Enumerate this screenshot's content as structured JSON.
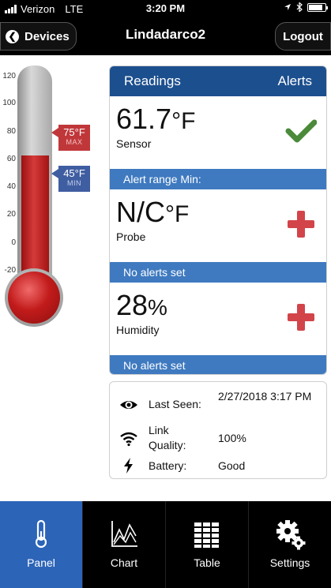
{
  "status_bar": {
    "carrier": "Verizon",
    "network": "LTE",
    "time": "3:20 PM"
  },
  "nav": {
    "back_label": "Devices",
    "title": "Lindadarco2",
    "logout_label": "Logout"
  },
  "thermometer": {
    "scale": [
      "120",
      "100",
      "80",
      "60",
      "40",
      "20",
      "0",
      "-20"
    ],
    "level_f": 63,
    "max": {
      "value": "75°F",
      "label": "MAX"
    },
    "min": {
      "value": "45°F",
      "label": "MIN"
    }
  },
  "readings": {
    "header_left": "Readings",
    "header_right": "Alerts",
    "items": [
      {
        "value": "61.7",
        "unit": "°F",
        "name": "Sensor",
        "alert_icon": "check-icon",
        "alert_text": "Alert range Min:"
      },
      {
        "value": "N/C",
        "unit": "°F",
        "name": "Probe",
        "alert_icon": "plus-icon",
        "alert_text": "No alerts set"
      },
      {
        "value": "28",
        "unit": "%",
        "name": "Humidity",
        "alert_icon": "plus-icon",
        "alert_text": "No alerts set"
      }
    ]
  },
  "info": {
    "last_seen_label": "Last Seen:",
    "last_seen_value": "2/27/2018 3:17 PM",
    "link_quality_label": "Link Quality:",
    "link_quality_value": "100%",
    "battery_label": "Battery:",
    "battery_value": "Good"
  },
  "tabs": [
    {
      "label": "Panel",
      "icon": "thermometer-icon",
      "active": true
    },
    {
      "label": "Chart",
      "icon": "chart-icon",
      "active": false
    },
    {
      "label": "Table",
      "icon": "table-icon",
      "active": false
    },
    {
      "label": "Settings",
      "icon": "gear-icon",
      "active": false
    }
  ],
  "colors": {
    "header_blue": "#1c4f8e",
    "alert_bar_blue": "#3f7ac0",
    "check_green": "#4a8a3a",
    "plus_red": "#d2444a",
    "active_tab": "#2c64b8"
  }
}
